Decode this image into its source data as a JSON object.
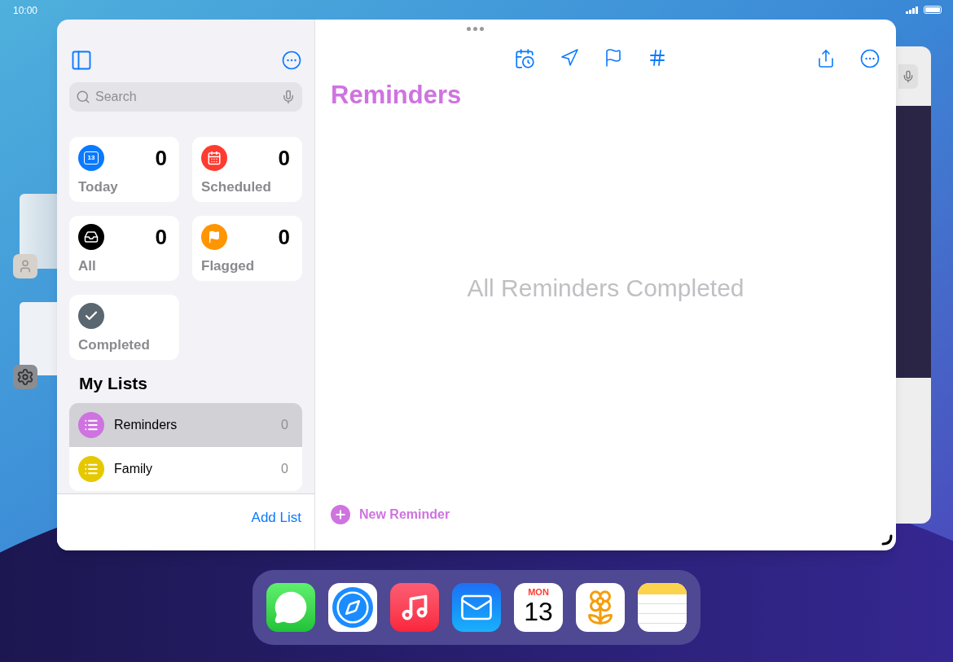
{
  "status_bar": {
    "time": "10:00"
  },
  "sidebar": {
    "search": {
      "placeholder": "Search"
    },
    "smart_lists": [
      {
        "kind": "today",
        "label": "Today",
        "count": "0",
        "color": "#0a7aff",
        "icon_text": "13"
      },
      {
        "kind": "scheduled",
        "label": "Scheduled",
        "count": "0",
        "color": "#ff3b30"
      },
      {
        "kind": "all",
        "label": "All",
        "count": "0",
        "color": "#000000"
      },
      {
        "kind": "flagged",
        "label": "Flagged",
        "count": "0",
        "color": "#ff9500"
      },
      {
        "kind": "completed",
        "label": "Completed",
        "color": "#5a6670"
      }
    ],
    "my_lists_title": "My Lists",
    "my_lists": [
      {
        "name": "Reminders",
        "count": "0",
        "color": "#cf73e0",
        "selected": true
      },
      {
        "name": "Family",
        "count": "0",
        "color": "#e6c800",
        "selected": false
      }
    ],
    "add_list": "Add List"
  },
  "main": {
    "title": "Reminders",
    "empty_message": "All Reminders Completed",
    "new_reminder": "New Reminder"
  },
  "dock": [
    {
      "kind": "messages"
    },
    {
      "kind": "safari"
    },
    {
      "kind": "music"
    },
    {
      "kind": "mail"
    },
    {
      "kind": "calendar",
      "weekday": "MON",
      "day": "13"
    },
    {
      "kind": "photos"
    },
    {
      "kind": "notes"
    }
  ]
}
